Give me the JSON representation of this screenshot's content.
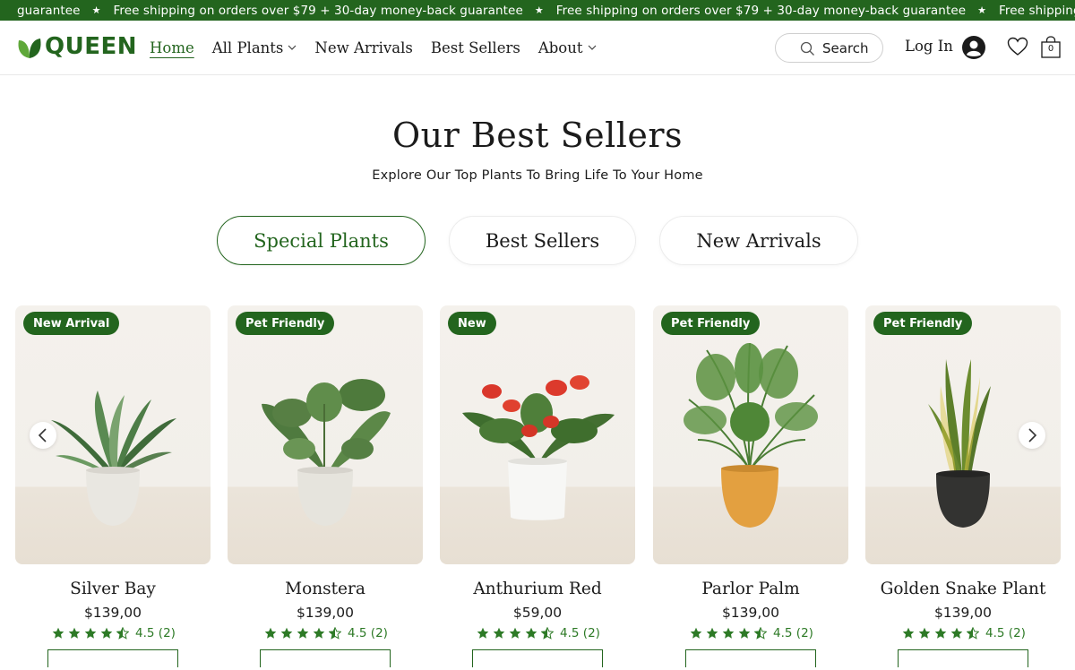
{
  "announcement": {
    "text_partial": "guarantee",
    "text": "Free shipping on orders over $79 + 30-day money-back guarantee",
    "text_tail": "Free shipping on orders over $79 +"
  },
  "header": {
    "logo_text": "QUEEN",
    "nav": [
      {
        "label": "Home",
        "active": true,
        "dropdown": false
      },
      {
        "label": "All Plants",
        "active": false,
        "dropdown": true
      },
      {
        "label": "New Arrivals",
        "active": false,
        "dropdown": false
      },
      {
        "label": "Best Sellers",
        "active": false,
        "dropdown": false
      },
      {
        "label": "About",
        "active": false,
        "dropdown": true
      }
    ],
    "search_label": "Search",
    "login_label": "Log In",
    "cart_count": "0"
  },
  "section": {
    "title": "Our Best Sellers",
    "subtitle": "Explore Our Top Plants To Bring Life To Your Home",
    "tabs": [
      {
        "label": "Special Plants",
        "active": true
      },
      {
        "label": "Best Sellers",
        "active": false
      },
      {
        "label": "New Arrivals",
        "active": false
      }
    ]
  },
  "products": [
    {
      "badge": "New Arrival",
      "name": "Silver Bay",
      "price": "$139,00",
      "rating_text": "4.5 (2)",
      "rating": 4.5,
      "pot": "white"
    },
    {
      "badge": "Pet Friendly",
      "name": "Monstera",
      "price": "$139,00",
      "rating_text": "4.5 (2)",
      "rating": 4.5,
      "pot": "white"
    },
    {
      "badge": "New",
      "name": "Anthurium Red",
      "price": "$59,00",
      "rating_text": "4.5 (2)",
      "rating": 4.5,
      "pot": "white"
    },
    {
      "badge": "Pet Friendly",
      "name": "Parlor Palm",
      "price": "$139,00",
      "rating_text": "4.5 (2)",
      "rating": 4.5,
      "pot": "orange"
    },
    {
      "badge": "Pet Friendly",
      "name": "Golden Snake Plant",
      "price": "$139,00",
      "rating_text": "4.5 (2)",
      "rating": 4.5,
      "pot": "black"
    }
  ],
  "colors": {
    "brand_green": "#23651e",
    "rating_green": "#2d7a26"
  }
}
